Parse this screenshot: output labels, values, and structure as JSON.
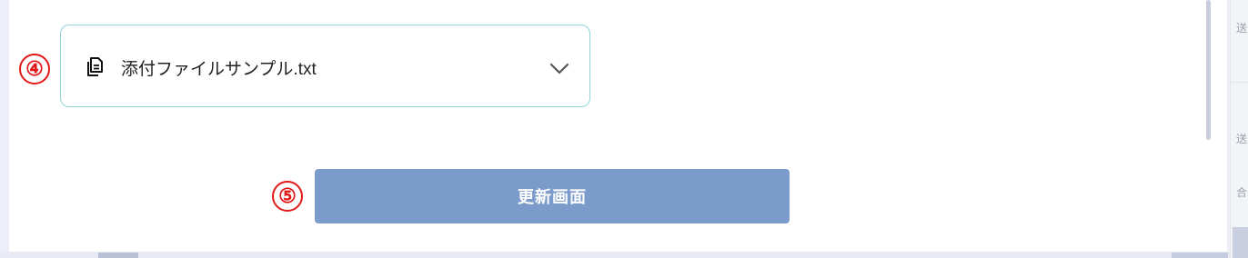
{
  "markers": {
    "attachment": "④",
    "update": "⑤"
  },
  "attachment": {
    "icon": "document-copy-icon",
    "filename": "添付ファイルサンプル.txt",
    "toggle_icon": "chevron-down-icon"
  },
  "update_button": {
    "label": "更新画面"
  },
  "right_edge_fragments": [
    "送",
    "送",
    "合"
  ],
  "colors": {
    "marker_red": "#e31818",
    "attach_border": "#8fd4da",
    "button_bg": "#7b9bcb",
    "button_text": "#ffffff",
    "page_bg": "#eeeef8"
  }
}
